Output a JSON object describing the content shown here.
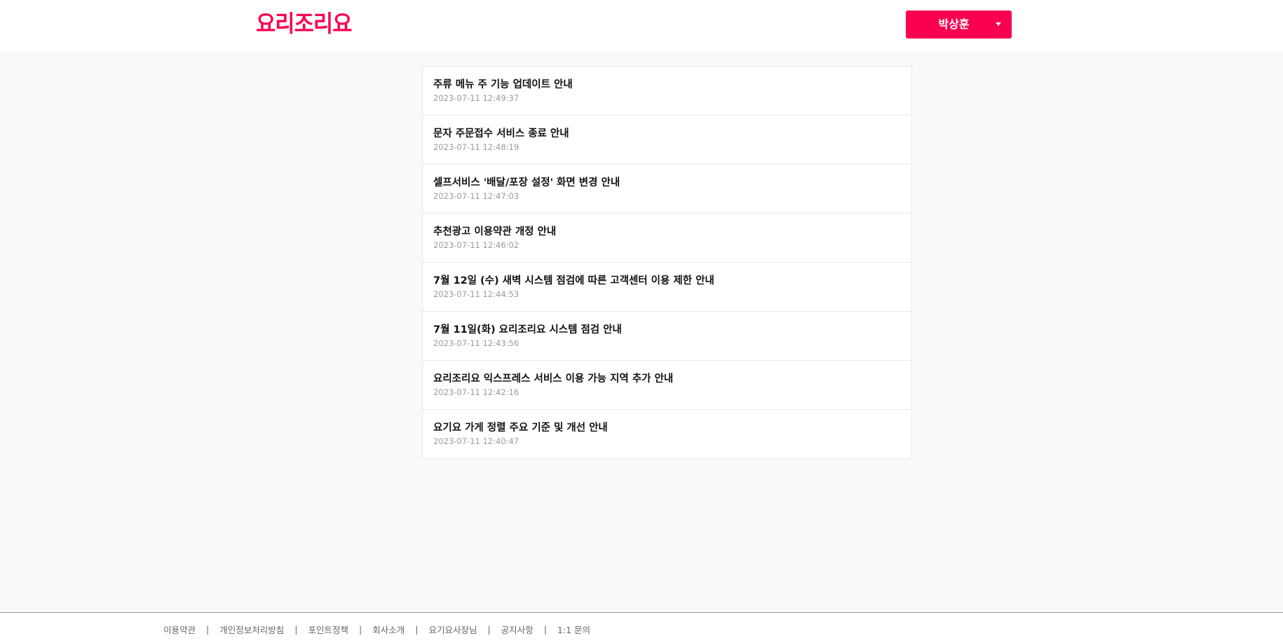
{
  "header": {
    "logo": "요리조리요",
    "user_name": "박상훈",
    "brand_color": "#fa0050"
  },
  "notices": [
    {
      "title": "주류 메뉴 주 기능 업데이트 안내",
      "date": "2023-07-11 12:49:37"
    },
    {
      "title": "문자 주문접수 서비스 종료 안내",
      "date": "2023-07-11 12:48:19"
    },
    {
      "title": "셀프서비스 '배달/포장 설정' 화면 변경 안내",
      "date": "2023-07-11 12:47:03"
    },
    {
      "title": "추천광고 이용약관 개정 안내",
      "date": "2023-07-11 12:46:02"
    },
    {
      "title": "7월 12일 (수) 새벽 시스템 점검에 따른 고객센터 이용 제한 안내",
      "date": "2023-07-11 12:44:53"
    },
    {
      "title": "7월 11일(화) 요리조리요 시스템 점검 안내",
      "date": "2023-07-11 12:43:56"
    },
    {
      "title": "요리조리요 익스프레스 서비스 이용 가능 지역 추가 안내",
      "date": "2023-07-11 12:42:16"
    },
    {
      "title": "요기요 가게 정렬 주요 기준 및 개선 안내",
      "date": "2023-07-11 12:40:47"
    }
  ],
  "footer": {
    "links": [
      "이용약관",
      "개인정보처리방침",
      "포인트정책",
      "회사소개",
      "요기요사장님",
      "공지사항",
      "1:1 문의"
    ],
    "separator": "|"
  }
}
